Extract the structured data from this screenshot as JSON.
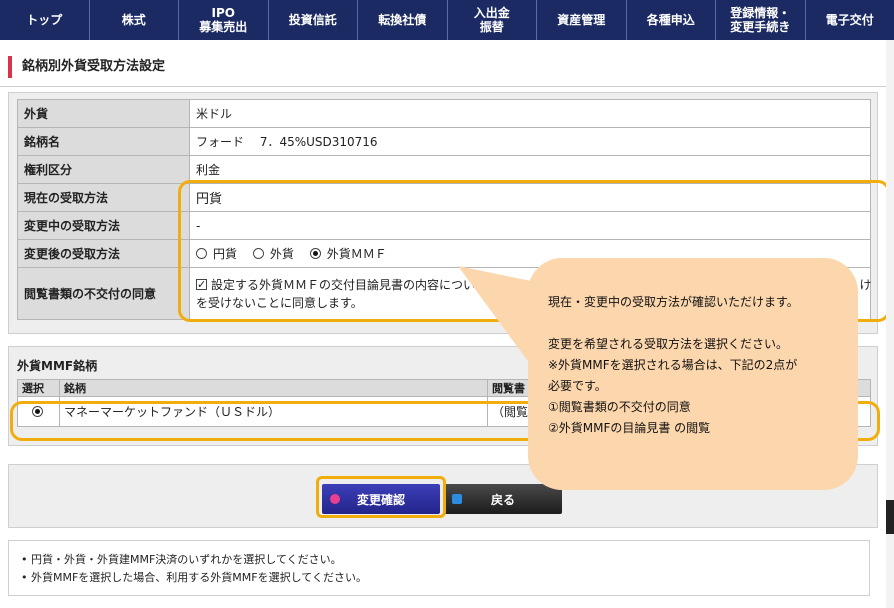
{
  "nav": [
    {
      "label": "トップ"
    },
    {
      "label": "株式"
    },
    {
      "label": "IPO\n募集売出"
    },
    {
      "label": "投資信託"
    },
    {
      "label": "転換社債"
    },
    {
      "label": "入出金\n振替"
    },
    {
      "label": "資産管理"
    },
    {
      "label": "各種申込"
    },
    {
      "label": "登録情報・\n変更手続き"
    },
    {
      "label": "電子交付"
    }
  ],
  "page_title": "銘柄別外貨受取方法設定",
  "info": {
    "currency_label": "外貨",
    "currency_value": "米ドル",
    "issue_label": "銘柄名",
    "issue_value": "フォード　 7．45%USD310716",
    "right_label": "権利区分",
    "right_value": "利金",
    "current_label": "現在の受取方法",
    "current_value": "円貨",
    "changing_label": "変更中の受取方法",
    "changing_value": "-",
    "after_label": "変更後の受取方法",
    "options": {
      "yen": "円貨",
      "foreign": "外貨",
      "mmf": "外貨ＭＭＦ"
    },
    "consent_label": "閲覧書類の不交付の同意",
    "consent_text_line1": "設定する外貨ＭＭＦの交付目論見書の内容について理解し",
    "consent_text_tail": "け",
    "consent_text_line2": "を受けないことに同意します。"
  },
  "mmf": {
    "title": "外貨MMF銘柄",
    "col_select": "選択",
    "col_name": "銘柄",
    "col_doc": "閲覧書",
    "row_name": "マネーマーケットファンド（ＵＳドル）",
    "row_doc": "（閲覧"
  },
  "buttons": {
    "confirm": "変更確認",
    "back": "戻る"
  },
  "notes": [
    "円貨・外貨・外貨建MMF決済のいずれかを選択してください。",
    "外貨MMFを選択した場合、利用する外貨MMFを選択してください。"
  ],
  "callout": {
    "line1": "現在・変更中の受取方法が確認いただけます。",
    "line2": "変更を希望される受取方法を選択ください。",
    "line3": "※外貨MMFを選択される場合は、下記の2点が",
    "line4": "必要です。",
    "line5": "①閲覧書類の不交付の同意",
    "line6": "②外貨MMFの目論見書 の閲覧"
  },
  "colors": {
    "nav": "#1b2a63",
    "accent": "#d9334a",
    "highlight": "#f1ad0b",
    "callout": "#fcd6ad"
  }
}
